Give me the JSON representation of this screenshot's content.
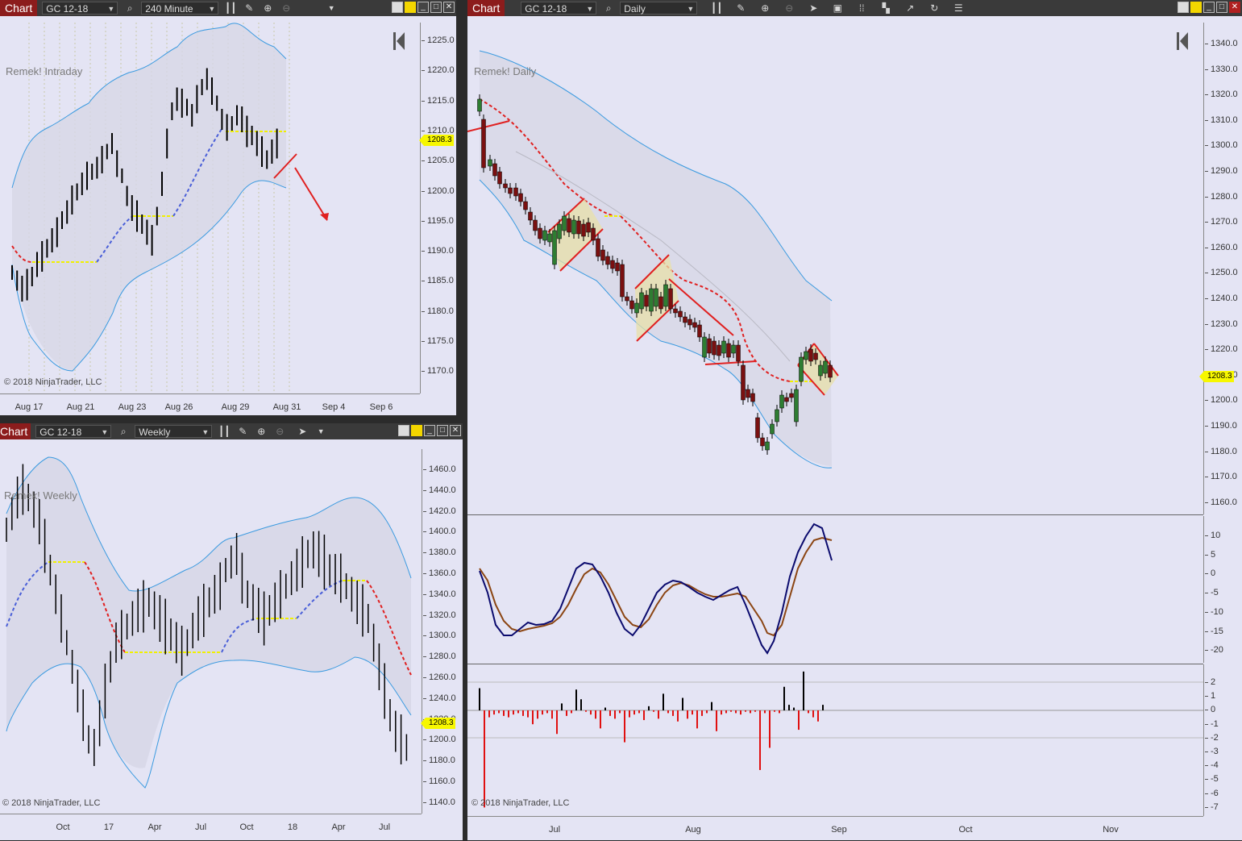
{
  "windows": {
    "intraday": {
      "tab_label": "Chart",
      "instrument": "GC 12-18",
      "interval": "240 Minute",
      "title": "Remek! Intraday",
      "copyright": "© 2018 NinjaTrader, LLC",
      "price_marker": "1208.3",
      "y_ticks": [
        "1225.0",
        "1220.0",
        "1215.0",
        "1210.0",
        "1205.0",
        "1200.0",
        "1195.0",
        "1190.0",
        "1185.0",
        "1180.0",
        "1175.0",
        "1170.0"
      ],
      "x_ticks": [
        "Aug 17",
        "Aug 21",
        "Aug 23",
        "Aug 26",
        "Aug 29",
        "Aug 31",
        "Sep 4",
        "Sep 6"
      ]
    },
    "weekly": {
      "tab_label": "Chart",
      "instrument": "GC 12-18",
      "interval": "Weekly",
      "title": "Remek! Weekly",
      "copyright": "© 2018 NinjaTrader, LLC",
      "price_marker": "1208.3",
      "y_ticks": [
        "1460.0",
        "1440.0",
        "1420.0",
        "1400.0",
        "1380.0",
        "1360.0",
        "1340.0",
        "1320.0",
        "1300.0",
        "1280.0",
        "1260.0",
        "1240.0",
        "1220.0",
        "1200.0",
        "1180.0",
        "1160.0",
        "1140.0"
      ],
      "x_ticks": [
        "Oct",
        "17",
        "Apr",
        "Jul",
        "Oct",
        "18",
        "Apr",
        "Jul"
      ]
    },
    "daily": {
      "tab_label": "Chart",
      "instrument": "GC 12-18",
      "interval": "Daily",
      "title": "Remek! Daily",
      "copyright": "© 2018 NinjaTrader, LLC",
      "price_marker": "1208.3",
      "y_ticks": [
        "1340.0",
        "1330.0",
        "1320.0",
        "1310.0",
        "1300.0",
        "1290.0",
        "1280.0",
        "1270.0",
        "1260.0",
        "1250.0",
        "1240.0",
        "1230.0",
        "1220.0",
        "1210.0",
        "1200.0",
        "1190.0",
        "1180.0",
        "1170.0",
        "1160.0"
      ],
      "osc_ticks": [
        "10",
        "5",
        "0",
        "-5",
        "-10",
        "-15",
        "-20"
      ],
      "hist_ticks": [
        "2",
        "1",
        "0",
        "-1",
        "-2",
        "-3",
        "-4",
        "-5",
        "-6",
        "-7"
      ],
      "x_ticks": [
        "Jul",
        "Aug",
        "Sep",
        "Oct",
        "Nov"
      ]
    }
  },
  "colors": {
    "candle_up": "#2e7d32",
    "candle_down": "#7a1010",
    "envelope": "#3a9ae0",
    "midline_down": "#e02020",
    "midline_up": "#4a5fd8",
    "flat_segment": "#f0f000",
    "oscillator_fast": "#0b0b6e",
    "oscillator_slow": "#8b4513",
    "hist_up": "#000000",
    "hist_down": "#e01010",
    "price_marker": "#f7f700",
    "tab": "#8c1c1c"
  },
  "icons": [
    "search-icon",
    "bar-style-icon",
    "pencil-icon",
    "zoom-in-icon",
    "zoom-out-icon",
    "pointer-icon",
    "properties-icon",
    "indicators-icon",
    "strategies-icon",
    "drawing-tools-icon",
    "refresh-icon",
    "list-icon",
    "skip-to-end-icon"
  ]
}
